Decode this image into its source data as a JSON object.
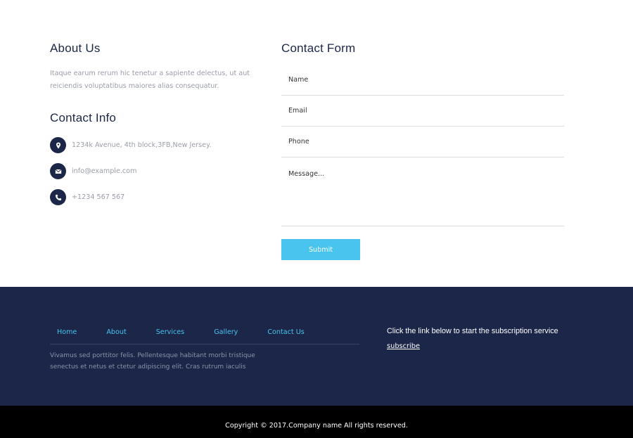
{
  "about": {
    "title": "About Us",
    "text": "Itaque earum rerum hic tenetur a sapiente delectus, ut aut reiciendis voluptatibus maiores alias consequatur."
  },
  "contact_info": {
    "title": "Contact Info",
    "items": [
      {
        "icon": "map-pin-icon",
        "text": "1234k Avenue, 4th block,3FB,New Jersey."
      },
      {
        "icon": "envelope-icon",
        "text": "info@example.com"
      },
      {
        "icon": "phone-icon",
        "text": "+1234 567 567"
      }
    ]
  },
  "contact_form": {
    "title": "Contact Form",
    "name_placeholder": "Name",
    "email_placeholder": "Email",
    "phone_placeholder": "Phone",
    "message_placeholder": "Message...",
    "submit_label": "Submit"
  },
  "footer": {
    "nav": [
      "Home",
      "About",
      "Services",
      "Gallery",
      "Contact Us"
    ],
    "description": "Vivamus sed porttitor felis. Pellentesque habitant morbi tristique senectus et netus et ctetur adipiscing elit. Cras rutrum iaculis",
    "subscribe_text": "Click the link below to start the subscription service",
    "subscribe_link": "subscribe"
  },
  "copyright": "Copyright © 2017.Company name All rights reserved.",
  "colors": {
    "navy": "#1b2649",
    "accent": "#48c4ee",
    "black": "#000000"
  }
}
